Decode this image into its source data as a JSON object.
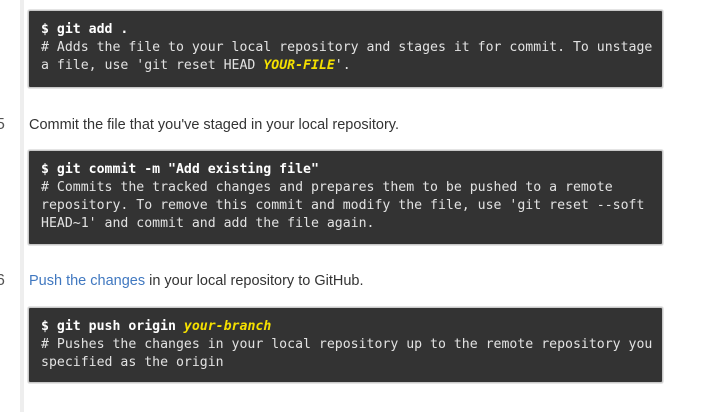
{
  "steps": [
    {
      "number": ""
    },
    {
      "number": "5",
      "text": "Commit the file that you've staged in your local repository."
    },
    {
      "number": "6",
      "link": "Push the changes",
      "text": " in your local repository to GitHub."
    }
  ],
  "blocks": [
    {
      "cmd": "$ git add .",
      "comment1_a": "# Adds the file to your local repository and stages it for commit. To unstage",
      "comment2_a": "a file, use 'git reset HEAD ",
      "comment2_hl": "YOUR-FILE",
      "comment2_b": "'."
    },
    {
      "cmd": "$ git commit -m \"Add existing file\"",
      "comment1": "# Commits the tracked changes and prepares them to be pushed to a remote",
      "comment2": "repository. To remove this commit and modify the file, use 'git reset --soft",
      "comment3": "HEAD~1' and commit and add the file again."
    },
    {
      "cmd_a": "$ git push origin ",
      "cmd_hl": "your-branch",
      "comment1": "# Pushes the changes in your local repository up to the remote repository you",
      "comment2": "specified as the origin"
    }
  ]
}
